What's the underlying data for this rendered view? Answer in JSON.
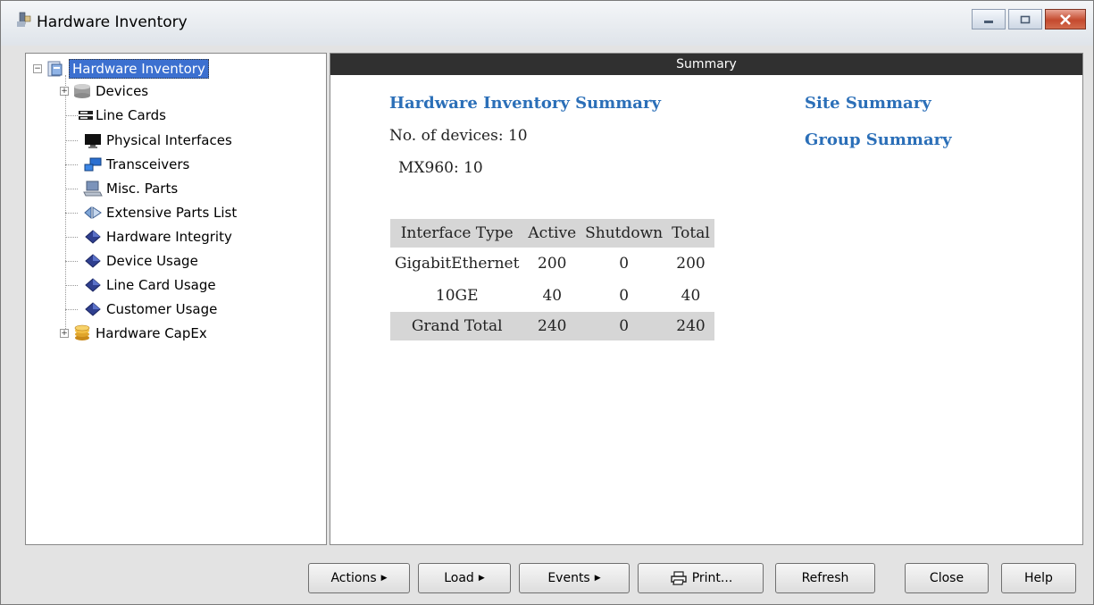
{
  "window": {
    "title": "Hardware Inventory"
  },
  "tree": {
    "root": "Hardware Inventory",
    "items": [
      {
        "label": "Devices",
        "icon": "disk-icon",
        "expandable": true
      },
      {
        "label": "Line Cards",
        "icon": "line-card-icon"
      },
      {
        "label": "Physical Interfaces",
        "icon": "monitor-icon"
      },
      {
        "label": "Transceivers",
        "icon": "transceiver-icon"
      },
      {
        "label": "Misc. Parts",
        "icon": "laptop-icon"
      },
      {
        "label": "Extensive Parts List",
        "icon": "parts-list-icon"
      },
      {
        "label": "Hardware Integrity",
        "icon": "diamond-icon"
      },
      {
        "label": "Device Usage",
        "icon": "diamond-icon"
      },
      {
        "label": "Line Card Usage",
        "icon": "diamond-icon"
      },
      {
        "label": "Customer Usage",
        "icon": "diamond-icon"
      },
      {
        "label": "Hardware CapEx",
        "icon": "coins-icon",
        "expandable": true
      }
    ]
  },
  "content": {
    "header": "Summary",
    "heading": "Hardware Inventory Summary",
    "device_count": "No. of devices: 10",
    "model_count": "MX960: 10",
    "links": {
      "site": "Site Summary",
      "group": "Group Summary"
    },
    "table": {
      "columns": [
        "Interface Type",
        "Active",
        "Shutdown",
        "Total"
      ],
      "rows": [
        [
          "GigabitEthernet",
          "200",
          "0",
          "200"
        ],
        [
          "10GE",
          "40",
          "0",
          "40"
        ]
      ],
      "total": [
        "Grand Total",
        "240",
        "0",
        "240"
      ]
    }
  },
  "buttons": {
    "actions": "Actions",
    "load": "Load",
    "events": "Events",
    "print": "Print...",
    "refresh": "Refresh",
    "close": "Close",
    "help": "Help"
  },
  "colors": {
    "link": "#2b6fb8",
    "header_bg": "#303030",
    "selection": "#3c70d0"
  }
}
